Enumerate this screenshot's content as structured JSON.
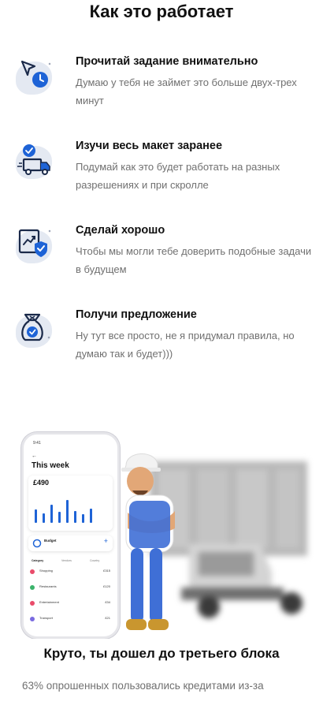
{
  "page": {
    "title": "Как это работает"
  },
  "steps": [
    {
      "icon": "cursor-clock-icon",
      "title": "Прочитай задание внимательно",
      "desc": "Думаю у тебя не займет это больше двух-трех минут"
    },
    {
      "icon": "delivery-truck-icon",
      "title": "Изучи весь макет заранее",
      "desc": "Подумай как это будет работать на разных разрешениях и при скролле"
    },
    {
      "icon": "chart-shield-icon",
      "title": "Сделай хорошо",
      "desc": "Чтобы мы могли тебе доверить подобные задачи в будущем"
    },
    {
      "icon": "money-bag-icon",
      "title": "Получи предложение",
      "desc": "Ну тут все просто, не я придумал правила, но думаю так и будет)))"
    }
  ],
  "promo": {
    "phone": {
      "time": "9:41",
      "heading": "This week",
      "amount": "£490",
      "budget": "Budget",
      "tabs": [
        "Category",
        "Vendors",
        "Country"
      ],
      "rows": [
        {
          "name": "Shopping",
          "value": "£315"
        },
        {
          "name": "Restaurants",
          "value": "£120"
        },
        {
          "name": "Entertainment",
          "value": "£34"
        },
        {
          "name": "Transport",
          "value": "£21"
        }
      ],
      "bars": [
        0.55,
        0.4,
        0.75,
        0.45,
        0.95,
        0.5,
        0.35,
        0.6
      ]
    }
  },
  "section": {
    "title": "Круто, ты дошел до третьего блока",
    "text": "63% опрошенных пользовались кредитами из-за"
  },
  "colors": {
    "accent": "#1e63d6",
    "icon_bg": "#e4e9f2",
    "muted": "#707070"
  }
}
